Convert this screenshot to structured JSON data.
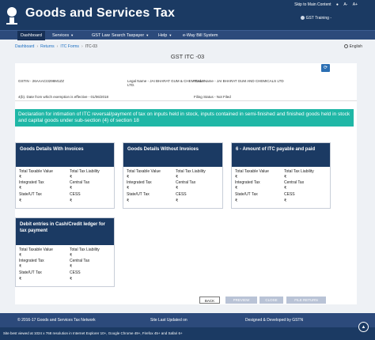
{
  "header": {
    "title": "Goods and Services Tax",
    "skip_link": "Skip to Main Content",
    "user_menu": "GST Training -"
  },
  "nav": {
    "items": [
      {
        "label": "Dashboard"
      },
      {
        "label": "Services"
      },
      {
        "label": "GST Law"
      },
      {
        "label": "Search Taxpayer"
      },
      {
        "label": "Help"
      },
      {
        "label": "e-Way Bill System"
      }
    ]
  },
  "breadcrumb": {
    "items": [
      "Dashboard",
      "Returns",
      "ITC Forms",
      "ITC-03"
    ]
  },
  "language": "English",
  "page_title": "GST ITC -03",
  "info": {
    "gstin": "GSTIN - 26AAACI3298M1ZZ",
    "legal_name": "Legal Name - JAI BHARAT GUM & CHEMICALS LTD.",
    "trade_name": "Trade Name - JAI BHARAT GUM AND CHEMICALS LTD",
    "exemption_date": "4(b). Date from which exemption is effective - 01/06/2018",
    "filing_status": "Filing Status - Not Filed"
  },
  "declaration": "Declaration for intimation of ITC reversal/payment of tax on inputs held in stock, inputs contained in semi-finished and finished goods held in stock and capital goods under sub-section (4) of section 18",
  "cards": [
    {
      "title": "Goods Details With Invoices",
      "fields": [
        {
          "label": "Total Taxable Value",
          "value": "₹"
        },
        {
          "label": "Total Tax Liability",
          "value": "₹"
        },
        {
          "label": "Integrated Tax",
          "value": "₹"
        },
        {
          "label": "Central Tax",
          "value": "₹"
        },
        {
          "label": "State/UT Tax",
          "value": "₹"
        },
        {
          "label": "CESS",
          "value": "₹"
        }
      ]
    },
    {
      "title": "Goods Details Without Invoices",
      "fields": [
        {
          "label": "Total Taxable Value",
          "value": "₹"
        },
        {
          "label": "Total Tax Liability",
          "value": "₹"
        },
        {
          "label": "Integrated Tax",
          "value": "₹"
        },
        {
          "label": "Central Tax",
          "value": "₹"
        },
        {
          "label": "State/UT Tax",
          "value": "₹"
        },
        {
          "label": "CESS",
          "value": "₹"
        }
      ]
    },
    {
      "title": "6 - Amount of ITC payable and paid",
      "fields": [
        {
          "label": "Total Taxable Value",
          "value": "₹"
        },
        {
          "label": "Total Tax Liability",
          "value": "₹"
        },
        {
          "label": "Integrated Tax",
          "value": "₹"
        },
        {
          "label": "Central Tax",
          "value": "₹"
        },
        {
          "label": "State/UT Tax",
          "value": "₹"
        },
        {
          "label": "CESS",
          "value": "₹"
        }
      ]
    },
    {
      "title": "Debit entries in Cash/Credit ledger for tax payment",
      "fields": [
        {
          "label": "Total Taxable Value",
          "value": "₹"
        },
        {
          "label": "Total Tax Liability",
          "value": "₹"
        },
        {
          "label": "Integrated Tax",
          "value": "₹"
        },
        {
          "label": "Central Tax",
          "value": "₹"
        },
        {
          "label": "State/UT Tax",
          "value": "₹"
        },
        {
          "label": "CESS",
          "value": "₹"
        }
      ]
    }
  ],
  "buttons": {
    "back": "BACK",
    "preview": "PREVIEW",
    "close": "CLOSE",
    "file_return": "FILE RETURN"
  },
  "footer": {
    "copyright": "© 2016-17 Goods and Services Tax Network",
    "last_updated": "Site Last Updated on",
    "designed_by": "Designed & Developed by GSTN",
    "browser_note": "Site best viewed at 1024 x 768 resolution in Internet Explorer 10+, Google Chrome 49+, Firefox 45+ and Safari 6+"
  },
  "colors": {
    "header": "#1b3a63",
    "nav": "#2c4a7b",
    "banner": "#1fb7a6",
    "card_head": "#1b3a63"
  }
}
